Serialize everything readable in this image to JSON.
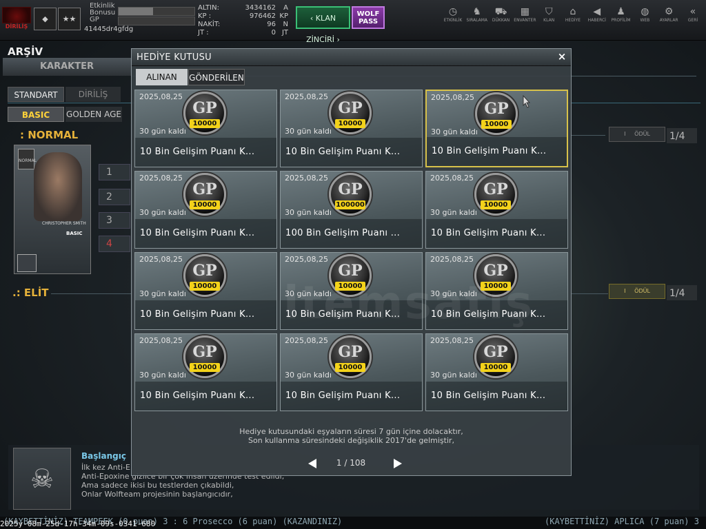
{
  "topbar": {
    "logo_text": "DİRİLİŞ",
    "rank_stars": "★★",
    "event_bonus_label": "Etkinlik Bonusu",
    "event_bonus_fill": 0.45,
    "gp_label": "GP",
    "nickname": "41445dr4gfdg",
    "currency": [
      {
        "label": "ALTIN:",
        "value": "3434162",
        "unit": "A"
      },
      {
        "label": "KP :",
        "value": "976462",
        "unit": "KP"
      },
      {
        "label": "NAKİT:",
        "value": "96",
        "unit": "N"
      },
      {
        "label": "JT :",
        "value": "0",
        "unit": "JT"
      }
    ],
    "klan_label": "‹ KLAN ZİNCİRİ ›",
    "wolf_label_1": "WOLF",
    "wolf_label_2": "PASS",
    "icons": [
      {
        "glyph": "◷",
        "label": "ETKİNLİK"
      },
      {
        "glyph": "♞",
        "label": "SIRALAMA"
      },
      {
        "glyph": "⛟",
        "label": "DÜKKAN"
      },
      {
        "glyph": "▦",
        "label": "ENVANTER"
      },
      {
        "glyph": "⛉",
        "label": "KLAN"
      },
      {
        "glyph": "⌂",
        "label": "HEDİYE"
      },
      {
        "glyph": "◀",
        "label": "HABERCİ"
      },
      {
        "glyph": "♟",
        "label": "PROFİLİM"
      },
      {
        "glyph": "◍",
        "label": "WEB"
      },
      {
        "glyph": "⚙",
        "label": "AYARLAR"
      },
      {
        "glyph": "«",
        "label": "GERİ"
      }
    ]
  },
  "page": {
    "title": "ARŞİV",
    "main_tab": "KARAKTER",
    "tabs": [
      "STANDART",
      "DİRİLİŞ"
    ],
    "subtabs": [
      "BASIC",
      "GOLDEN AGE"
    ],
    "normal_label": ": NORMAL",
    "elit_label": ".: ELİT",
    "character_name": "CHRISTOPHER SMITH",
    "character_tier": "BASIC",
    "character_badge": "NORMAL",
    "slots": [
      "1",
      "2",
      "3",
      "4"
    ],
    "reward_label": "ÖDÜL",
    "reward_rank": "I",
    "normal_progress": "1/4",
    "elit_progress": "1/4"
  },
  "story": {
    "title": "Başlangıç",
    "lines": [
      "İlk kez Anti-E",
      "Anti-Epoxine gizlice bir çok insan üzerinde test edildi,",
      "Ama sadece ikisi bu testlerden çıkabildi,",
      "Onlar Wolfteam projesinin başlangıcıdır,"
    ]
  },
  "ticker": {
    "timestamp": "2025y-08m-25d-17h-34m-09s-0341-680",
    "message": "(KAYBETTİNİZ) TEAMPEEK (0 puan) 3 : 6 Prosecco (6 puan) (KAZANDINIZ)",
    "message2": "(KAYBETTİNİZ) APLICA (7 puan) 3"
  },
  "modal": {
    "title": "HEDİYE KUTUSU",
    "close": "×",
    "tabs": {
      "received": "ALINAN",
      "sent": "GÖNDERİLEN"
    },
    "items": [
      {
        "date": "2025,08,25",
        "remaining": "30 gün kaldı",
        "name": "10 Bin Gelişim Puanı K...",
        "amount": "10000"
      },
      {
        "date": "2025,08,25",
        "remaining": "30 gün kaldı",
        "name": "10 Bin Gelişim Puanı K...",
        "amount": "10000"
      },
      {
        "date": "2025,08,25",
        "remaining": "30 gün kaldı",
        "name": "10 Bin Gelişim Puanı K...",
        "amount": "10000"
      },
      {
        "date": "2025,08,25",
        "remaining": "30 gün kaldı",
        "name": "10 Bin Gelişim Puanı K...",
        "amount": "10000"
      },
      {
        "date": "2025,08,25",
        "remaining": "30 gün kaldı",
        "name": "100 Bin Gelişim Puanı ...",
        "amount": "100000"
      },
      {
        "date": "2025,08,25",
        "remaining": "30 gün kaldı",
        "name": "10 Bin Gelişim Puanı K...",
        "amount": "10000"
      },
      {
        "date": "2025,08,25",
        "remaining": "30 gün kaldı",
        "name": "10 Bin Gelişim Puanı K...",
        "amount": "10000"
      },
      {
        "date": "2025,08,25",
        "remaining": "30 gün kaldı",
        "name": "10 Bin Gelişim Puanı K...",
        "amount": "10000"
      },
      {
        "date": "2025,08,25",
        "remaining": "30 gün kaldı",
        "name": "10 Bin Gelişim Puanı K...",
        "amount": "10000"
      },
      {
        "date": "2025,08,25",
        "remaining": "30 gün kaldı",
        "name": "10 Bin Gelişim Puanı K...",
        "amount": "10000"
      },
      {
        "date": "2025,08,25",
        "remaining": "30 gün kaldı",
        "name": "10 Bin Gelişim Puanı K...",
        "amount": "10000"
      },
      {
        "date": "2025,08,25",
        "remaining": "30 gün kaldı",
        "name": "10 Bin Gelişim Puanı K...",
        "amount": "10000"
      }
    ],
    "coin_text": "GP",
    "notice_1": "Hediye kutusundaki eşyaların süresi 7 gün içine dolacaktır,",
    "notice_2": "Son kullanma süresindeki değişiklik 2017'de gelmiştir,",
    "page": "1 / 108"
  }
}
